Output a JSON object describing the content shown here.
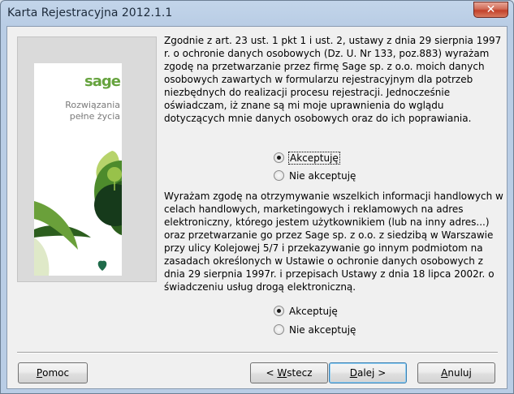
{
  "window": {
    "title": "Karta Rejestracyjna 2012.1.1",
    "close_glyph": "✕"
  },
  "banner": {
    "logo_text": "sage",
    "tagline_line1": "Rozwiązania",
    "tagline_line2": "pełne życia",
    "brand_color": "#66a33e"
  },
  "consent_data": {
    "text": "Zgodnie z art. 23 ust. 1 pkt 1 i ust. 2, ustawy z dnia 29 sierpnia 1997 r. o ochronie danych osobowych (Dz. U. Nr 133, poz.883) wyrażam zgodę na przetwarzanie przez firmę Sage sp. z o.o. moich danych osobowych zawartych w formularzu rejestracyjnym dla potrzeb niezbędnych do realizacji procesu rejestracji. Jednocześnie oświadczam, iż znane są mi moje uprawnienia do wglądu dotyczących mnie danych osobowych oraz do ich poprawiania.",
    "accept_label": "Akceptuję",
    "decline_label": "Nie akceptuję",
    "selected": "accept"
  },
  "consent_marketing": {
    "text": "Wyrażam zgodę na otrzymywanie wszelkich informacji handlowych w celach handlowych, marketingowych i reklamowych na adres elektroniczny, którego jestem użytkownikiem (lub na inny adres...) oraz przetwarzanie go przez Sage sp. z o.o. z siedzibą  w Warszawie przy ulicy Kolejowej 5/7 i przekazywanie go innym podmiotom na zasadach określonych w Ustawie o ochronie danych osobowych z dnia 29 sierpnia 1997r. i przepisach Ustawy z dnia 18 lipca 2002r. o świadczeniu usług drogą elektroniczną.",
    "accept_label": "Akceptuję",
    "decline_label": "Nie akceptuję",
    "selected": "accept"
  },
  "buttons": {
    "help_first": "P",
    "help_rest": "omoc",
    "back_prefix": "< ",
    "back_first": "W",
    "back_rest": "stecz",
    "next_first": "D",
    "next_rest": "alej >",
    "cancel_first": "A",
    "cancel_rest": "nuluj"
  }
}
